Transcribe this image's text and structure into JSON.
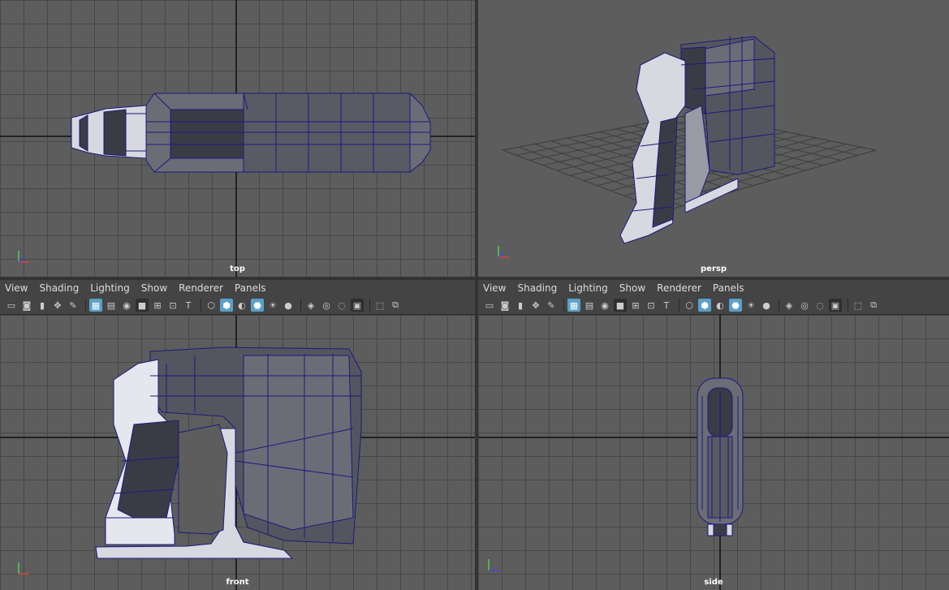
{
  "viewports": {
    "top": {
      "label": "top"
    },
    "persp": {
      "label": "persp"
    },
    "front": {
      "label": "front"
    },
    "side": {
      "label": "side"
    }
  },
  "menus": [
    "View",
    "Shading",
    "Lighting",
    "Show",
    "Renderer",
    "Panels"
  ],
  "axis_labels": {
    "x": "x",
    "y": "y",
    "z": "z"
  },
  "colors": {
    "viewport_bg": "#5d5d5d",
    "grid_line": "#474747",
    "wire": "#1a1a80",
    "mesh_dark": "#3b3b46",
    "mesh_mid": "#6c6c76",
    "mesh_light": "#e6e6ee",
    "toolbar_active": "#5aa0c8"
  },
  "toolbar_icons": [
    "camera-select-icon",
    "camera-attr-icon",
    "bookmark-icon",
    "pan-icon",
    "draw-icon",
    "grid-icon",
    "film-gate-icon",
    "resolution-gate-icon",
    "gate-mask-icon",
    "field-chart-icon",
    "safe-action-icon",
    "safe-title-icon",
    "wireframe-icon",
    "smooth-shade-icon",
    "shade-wire-icon",
    "wireframe-on-shaded-icon",
    "lights-icon",
    "shadows-icon",
    "isolate-icon",
    "xray-icon",
    "xray-joints-icon",
    "backface-icon",
    "ambient-occlusion-icon",
    "select-objects-icon",
    "maximize-icon"
  ]
}
